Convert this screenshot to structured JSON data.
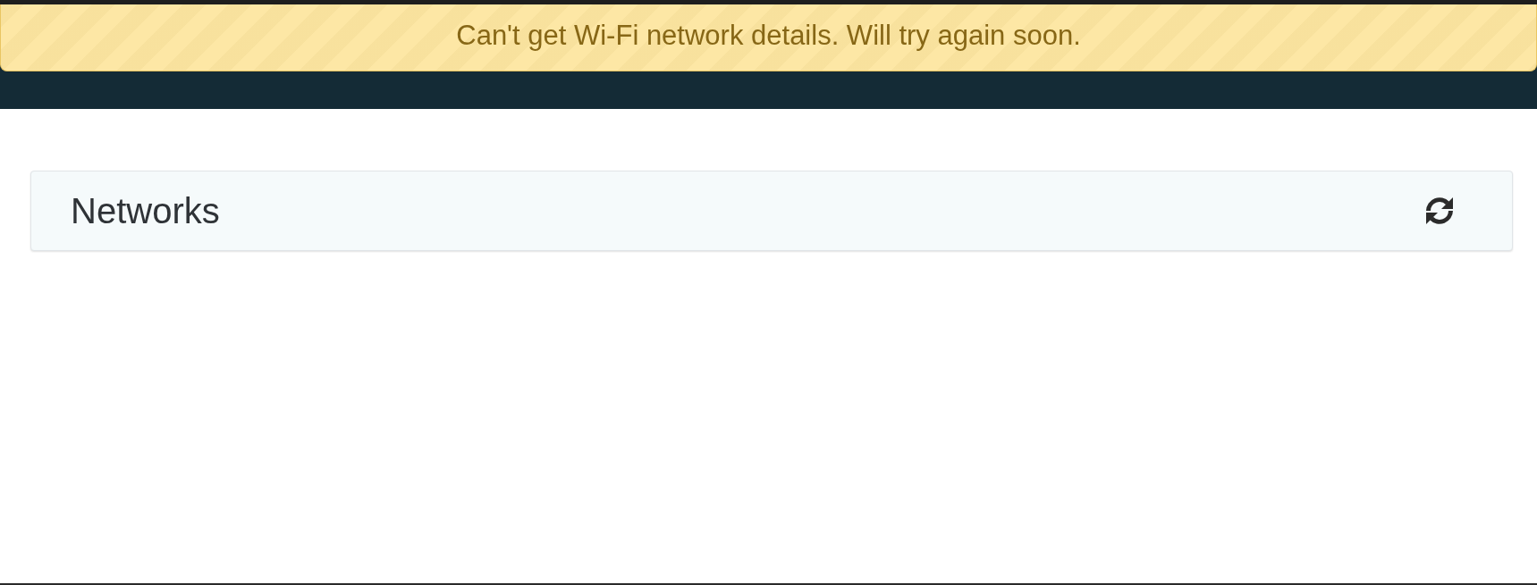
{
  "alert_banner": {
    "message": "Can't get Wi-Fi network details. Will try again soon."
  },
  "panels": [
    {
      "title": "Networks"
    }
  ]
}
